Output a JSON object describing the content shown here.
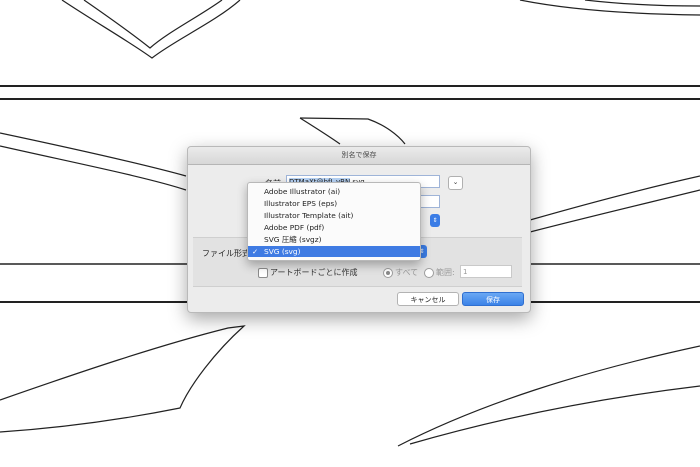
{
  "dialog": {
    "title": "別名で保存",
    "name_label": "名前:",
    "filename_selected": "DTMaXt@bfJ_vBN",
    "filename_ext": ".svg",
    "expand_icon": "chevron-down-icon",
    "format_label": "ファイル形式:",
    "artboard_checkbox_label": "アートボードごとに作成",
    "range_all_label": "すべて",
    "range_label": "範囲:",
    "range_value": "1",
    "cancel_label": "キャンセル",
    "save_label": "保存"
  },
  "format_menu": {
    "items": [
      "Adobe Illustrator (ai)",
      "Illustrator EPS (eps)",
      "Illustrator Template (ait)",
      "Adobe PDF (pdf)",
      "SVG 圧縮 (svgz)",
      "SVG (svg)"
    ],
    "selected": "SVG (svg)",
    "check": "✓"
  },
  "colors": {
    "accent": "#3f7be3",
    "dialog_bg": "#ececec",
    "selection": "#b5d2f5"
  }
}
